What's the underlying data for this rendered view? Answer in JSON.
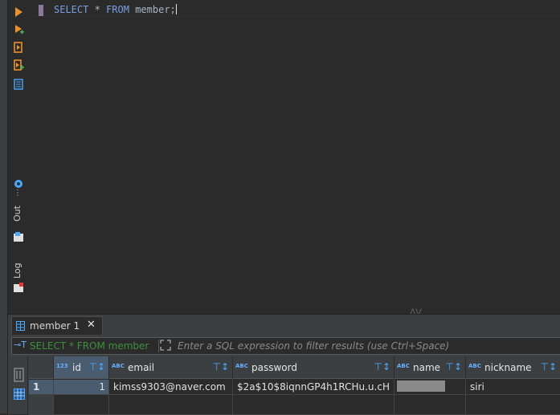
{
  "editor": {
    "query_keyword_select": "SELECT",
    "query_star": "*",
    "query_keyword_from": "FROM",
    "query_table": "member;"
  },
  "side_toolbar": {
    "out_label": "Out",
    "log_label": "Log"
  },
  "results": {
    "tab_label": "member 1",
    "tab_close": "✕",
    "filter": {
      "query_text": "SELECT * FROM member",
      "placeholder": "Enter a SQL expression to filter results (use Ctrl+Space)"
    },
    "columns": [
      {
        "type": "123",
        "name": "id"
      },
      {
        "type": "ABC",
        "name": "email"
      },
      {
        "type": "ABC",
        "name": "password"
      },
      {
        "type": "ABC",
        "name": "name"
      },
      {
        "type": "ABC",
        "name": "nickname"
      }
    ],
    "rows": [
      {
        "row_number": "1",
        "id": "1",
        "email": "kimss9303@naver.com",
        "password": "$2a$10$8iqnnGP4h1RCHu.u.cH",
        "name": "",
        "nickname": "siri"
      }
    ]
  },
  "colors": {
    "accent_blue": "#4aa8ff",
    "keyword": "#7a9fe0",
    "filter_query_green": "#3e8f3e",
    "run_orange": "#e8912d"
  }
}
